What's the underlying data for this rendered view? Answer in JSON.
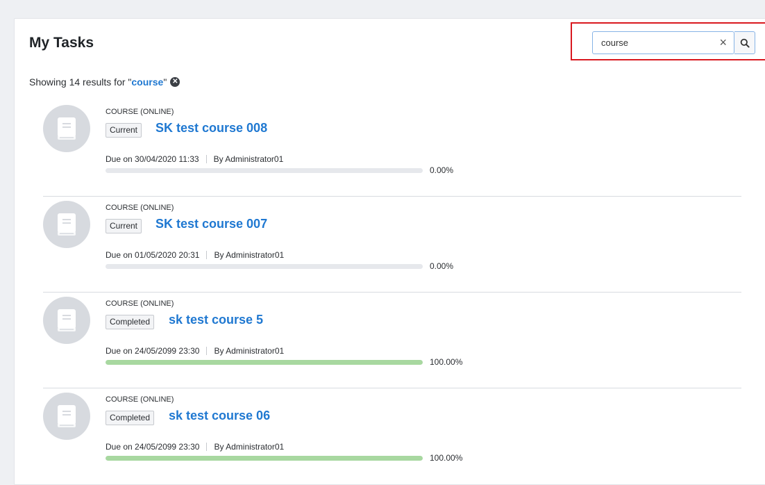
{
  "page": {
    "title": "My Tasks"
  },
  "search": {
    "value": "course",
    "placeholder": "",
    "clear_glyph": "×",
    "button_icon": "search-icon"
  },
  "results": {
    "prefix": "Showing 14 results for \"",
    "term": "course",
    "suffix": "\"",
    "clear_icon": "close-circle-icon"
  },
  "colors": {
    "accent": "#1f78d1",
    "highlight_border": "#d9181f",
    "progress_complete": "#a8d8a0",
    "progress_track": "#e6e8ec"
  },
  "tasks": [
    {
      "type": "COURSE (ONLINE)",
      "status": "Current",
      "title": "SK test course 008",
      "due": "Due on 30/04/2020 11:33",
      "by": "By Administrator01",
      "progress": 0,
      "progress_label": "0.00%",
      "icon": "book-icon"
    },
    {
      "type": "COURSE (ONLINE)",
      "status": "Current",
      "title": "SK test course 007",
      "due": "Due on 01/05/2020 20:31",
      "by": "By Administrator01",
      "progress": 0,
      "progress_label": "0.00%",
      "icon": "book-icon"
    },
    {
      "type": "COURSE (ONLINE)",
      "status": "Completed",
      "title": "sk test course 5",
      "due": "Due on 24/05/2099 23:30",
      "by": "By Administrator01",
      "progress": 100,
      "progress_label": "100.00%",
      "icon": "book-icon"
    },
    {
      "type": "COURSE (ONLINE)",
      "status": "Completed",
      "title": "sk test course 06",
      "due": "Due on 24/05/2099 23:30",
      "by": "By Administrator01",
      "progress": 100,
      "progress_label": "100.00%",
      "icon": "book-icon"
    }
  ]
}
